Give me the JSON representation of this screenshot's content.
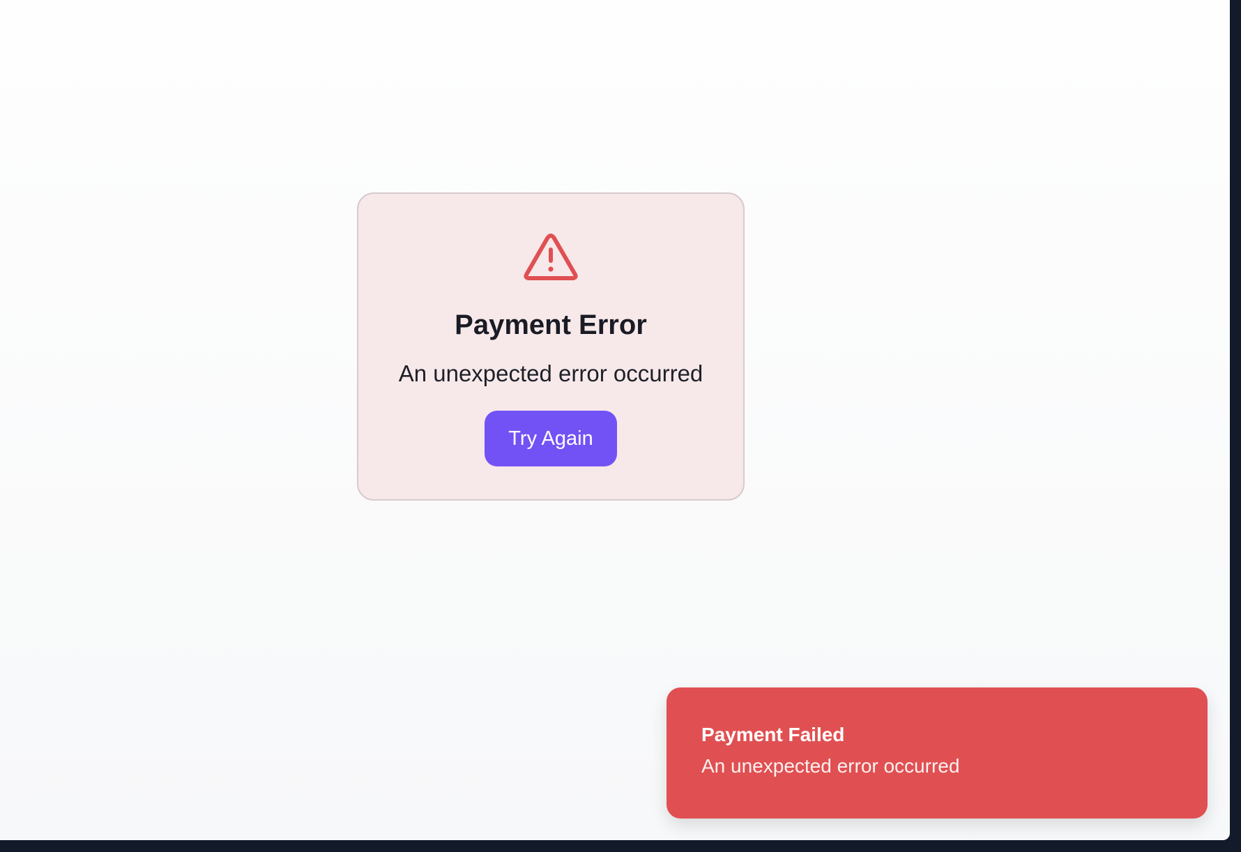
{
  "error_card": {
    "icon": "warning-triangle-icon",
    "title": "Payment Error",
    "message": "An unexpected error occurred",
    "retry_label": "Try Again"
  },
  "toast": {
    "title": "Payment Failed",
    "message": "An unexpected error occurred"
  },
  "colors": {
    "accent": "#7352f5",
    "error": "#e05052",
    "card_background": "#f7e9ea",
    "icon": "#e05052"
  }
}
